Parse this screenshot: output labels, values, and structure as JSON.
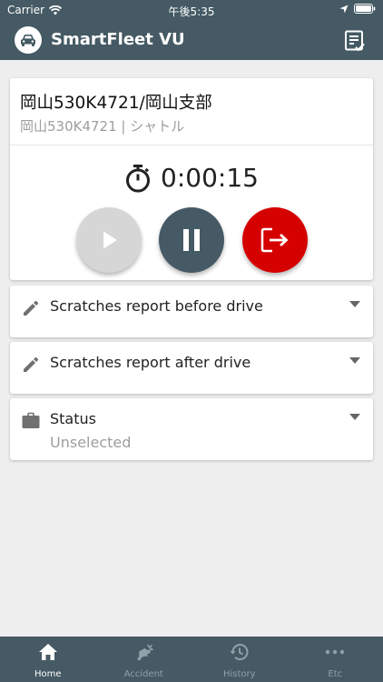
{
  "status_bar": {
    "carrier": "Carrier",
    "time": "午後5:35"
  },
  "app_bar": {
    "title": "SmartFleet VU",
    "logo_icon": "car-icon",
    "menu_icon": "checklist-icon"
  },
  "vehicle": {
    "title": "岡山530K4721/岡山支部",
    "subtitle": "岡山530K4721 | シャトル"
  },
  "timer": {
    "value": "0:00:15",
    "icon": "stopwatch-icon"
  },
  "controls": {
    "play_icon": "play-icon",
    "pause_icon": "pause-icon",
    "exit_icon": "exit-icon",
    "colors": {
      "play_disabled": "#d6d6d6",
      "pause": "#455a64",
      "exit": "#d50000"
    }
  },
  "reports": [
    {
      "label": "Scratches report before drive",
      "icon": "pencil-icon"
    },
    {
      "label": "Scratches report after drive",
      "icon": "pencil-icon"
    }
  ],
  "status_field": {
    "label": "Status",
    "value": "Unselected",
    "icon": "briefcase-icon"
  },
  "bottom_nav": {
    "items": [
      {
        "label": "Home",
        "icon": "home-icon",
        "active": true
      },
      {
        "label": "Accident",
        "icon": "accident-icon",
        "active": false
      },
      {
        "label": "History",
        "icon": "history-icon",
        "active": false
      },
      {
        "label": "Etc",
        "icon": "more-icon",
        "active": false
      }
    ]
  },
  "theme": {
    "primary": "#455a64",
    "background": "#eeeeee",
    "danger": "#d50000"
  }
}
